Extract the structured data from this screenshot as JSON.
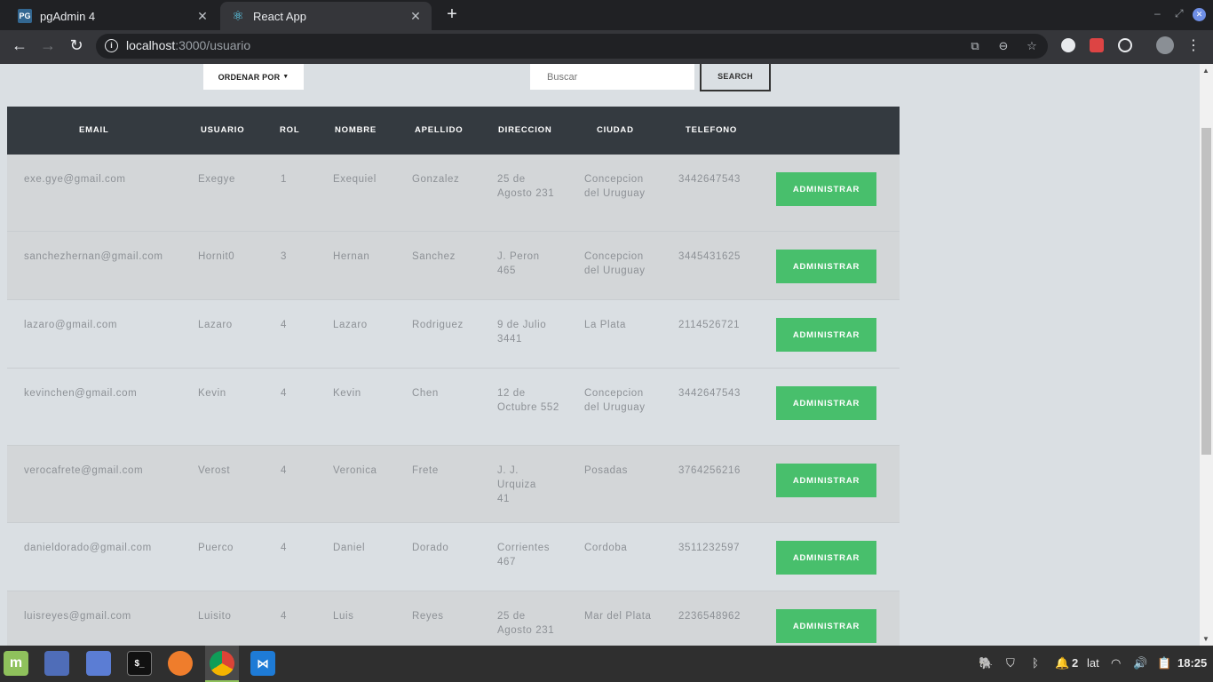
{
  "browser": {
    "tabs": [
      {
        "label": "pgAdmin 4",
        "icon": "PG",
        "active": false
      },
      {
        "label": "React App",
        "icon": "⚛",
        "active": true
      }
    ],
    "url_host": "localhost",
    "url_path": ":3000/usuario"
  },
  "controls": {
    "sort_label": "ORDENAR POR",
    "search_placeholder": "Buscar",
    "search_label": "SEARCH"
  },
  "table": {
    "headers": [
      "EMAIL",
      "USUARIO",
      "ROL",
      "NOMBRE",
      "APELLIDO",
      "DIRECCION",
      "CIUDAD",
      "TELEFONO"
    ],
    "action_label": "ADMINISTRAR",
    "rows": [
      {
        "email": "exe.gye@gmail.com",
        "usuario": "Exegye",
        "rol": "1",
        "nombre": "Exequiel",
        "apellido": "Gonzalez",
        "direccion": "25 de Agosto 231",
        "ciudad": "Concepcion del Uruguay",
        "telefono": "3442647543"
      },
      {
        "email": "sanchezhernan@gmail.com",
        "usuario": "Hornit0",
        "rol": "3",
        "nombre": "Hernan",
        "apellido": "Sanchez",
        "direccion": "J. Peron 465",
        "ciudad": "Concepcion del Uruguay",
        "telefono": "3445431625"
      },
      {
        "email": "lazaro@gmail.com",
        "usuario": "Lazaro",
        "rol": "4",
        "nombre": "Lazaro",
        "apellido": "Rodriguez",
        "direccion": "9 de Julio 3441",
        "ciudad": "La Plata",
        "telefono": "2114526721"
      },
      {
        "email": "kevinchen@gmail.com",
        "usuario": "Kevin",
        "rol": "4",
        "nombre": "Kevin",
        "apellido": "Chen",
        "direccion": "12 de Octubre 552",
        "ciudad": "Concepcion del Uruguay",
        "telefono": "3442647543"
      },
      {
        "email": "verocafrete@gmail.com",
        "usuario": "Verost",
        "rol": "4",
        "nombre": "Veronica",
        "apellido": "Frete",
        "direccion": "J. J. Urquiza 41",
        "ciudad": "Posadas",
        "telefono": "3764256216"
      },
      {
        "email": "danieldorado@gmail.com",
        "usuario": "Puerco",
        "rol": "4",
        "nombre": "Daniel",
        "apellido": "Dorado",
        "direccion": "Corrientes 467",
        "ciudad": "Cordoba",
        "telefono": "3511232597"
      },
      {
        "email": "luisreyes@gmail.com",
        "usuario": "Luisito",
        "rol": "4",
        "nombre": "Luis",
        "apellido": "Reyes",
        "direccion": "25 de Agosto 231",
        "ciudad": "Mar del Plata",
        "telefono": "2236548962"
      }
    ]
  },
  "taskbar": {
    "workspace": "2",
    "keyboard": "lat",
    "clock": "18:25"
  },
  "colors": {
    "accent_green": "#48bf6c",
    "table_header": "#343a40",
    "page_bg": "#dadfe3"
  }
}
